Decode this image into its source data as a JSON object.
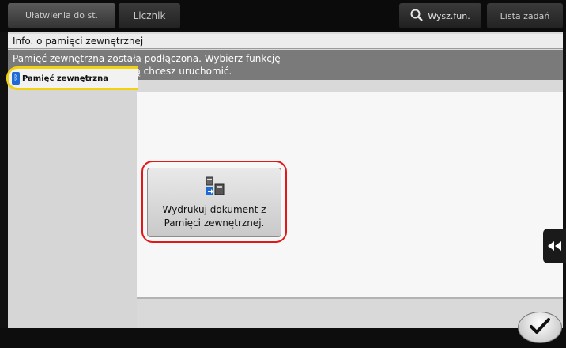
{
  "topbar": {
    "accessibility_label": "Ułatwienia do st.",
    "counter_label": "Licznik",
    "search_label": "Wysz.fun.",
    "jobs_label": "Lista zadań"
  },
  "header": {
    "title": "Info. o pamięci zewnętrznej",
    "message_line1": "Pamięć zewnętrzna została podłączona. Wybierz funkcję",
    "message_line2": "Pamięci zewnętrznej, którą chcesz uruchomić."
  },
  "tab": {
    "label": "Pamięć zewnętrzna"
  },
  "function": {
    "label_line1": "Wydrukuj dokument z",
    "label_line2": "Pamięci zewnętrznej."
  },
  "colors": {
    "tab_border": "#f2d20e",
    "highlight": "#e01818",
    "message_bg": "#7a7a7a"
  }
}
